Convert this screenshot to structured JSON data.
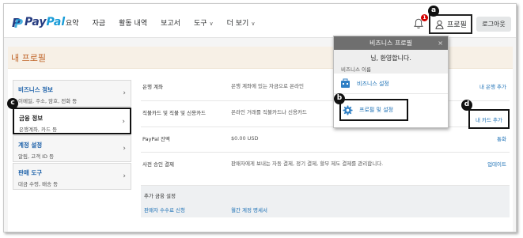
{
  "brand": {
    "pay": "Pay",
    "pal": "Pal"
  },
  "nav": {
    "items": [
      {
        "label": "요약",
        "dropdown": false
      },
      {
        "label": "자금",
        "dropdown": false
      },
      {
        "label": "활동 내역",
        "dropdown": false
      },
      {
        "label": "보고서",
        "dropdown": false
      },
      {
        "label": "도구",
        "dropdown": true
      },
      {
        "label": "더 보기",
        "dropdown": true
      }
    ]
  },
  "header": {
    "notification_count": "1",
    "profile_label": "프로필",
    "logout_label": "로그아웃"
  },
  "markers": {
    "a": "a",
    "b": "b",
    "c": "c",
    "d": "d"
  },
  "page": {
    "title": "내 프로필"
  },
  "sidebar": {
    "items": [
      {
        "title": "비즈니스 정보",
        "sub": "이메일, 주소, 암호, 전화 등"
      },
      {
        "title": "금융 정보",
        "sub": "은행계좌, 카드 등"
      },
      {
        "title": "계정 설정",
        "sub": "알림, 고객 ID 등"
      },
      {
        "title": "판매 도구",
        "sub": "대금 수령, 배송 등"
      }
    ]
  },
  "rows": [
    {
      "label": "은행 계좌",
      "desc": "은행 계좌에 있는 자금으로 온라인",
      "action": "내 은행 추가"
    },
    {
      "label": "직불카드 및 직불 및 신용카드",
      "desc": "온라인 거래를 직불카드나 신용카드",
      "action": "내 카드 추가"
    },
    {
      "label": "PayPal 잔액",
      "desc": "$0.00 USD",
      "action": "통화"
    },
    {
      "label": "사전 승인 결제",
      "desc": "판매자에게 보내는 자동 결제, 정기 결제, 할부 제도 결제를 관리합니다.",
      "action": "업데이트"
    }
  ],
  "extra": {
    "heading": "추가 금융 설정",
    "link1": "판매자 수수료 신청",
    "link2": "월간 계정 명세서"
  },
  "popup": {
    "title": "비즈니스 프로필",
    "close": "×",
    "welcome": "님, 환영합니다.",
    "business_name": "비즈니스 이름",
    "link_business_settings": "비즈니스 설정",
    "link_profile_settings": "프로필 및 설정"
  },
  "colors": {
    "brand_dark": "#253b80",
    "brand_light": "#179bd7",
    "link": "#1a6fb5",
    "title": "#c0652a",
    "badge": "#d20000"
  }
}
